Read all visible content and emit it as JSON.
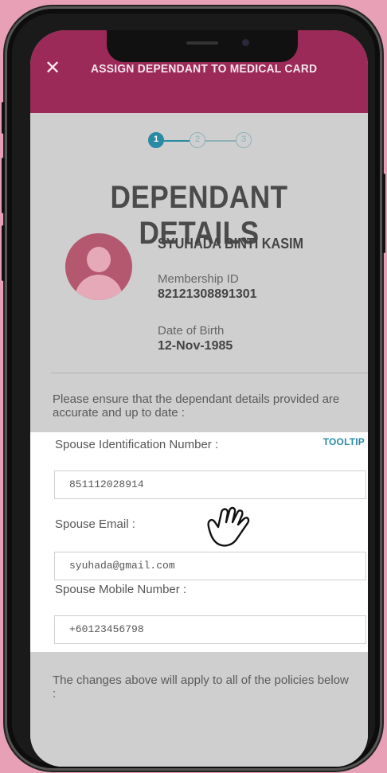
{
  "header": {
    "title": "ASSIGN DEPENDANT TO MEDICAL CARD",
    "close_icon": "close-icon"
  },
  "stepper": {
    "steps": [
      "1",
      "2",
      "3"
    ],
    "active": 1
  },
  "page_title": "DEPENDANT DETAILS",
  "dependant": {
    "name": "SYUHADA BINTI KASIM",
    "membership_label": "Membership ID",
    "membership_id": "82121308891301",
    "dob_label": "Date of Birth",
    "dob": "12-Nov-1985"
  },
  "instructions": "Please ensure that the dependant details provided are accurate and up to date :",
  "form": {
    "tooltip_label": "TOOLTIP",
    "id_label": "Spouse Identification Number :",
    "id_value": "851112028914",
    "email_label": "Spouse Email :",
    "email_value": "syuhada@gmail.com",
    "mobile_label": "Spouse Mobile Number :",
    "mobile_value": "+60123456798"
  },
  "footer_note": "The changes above will apply to all of the policies below :",
  "colors": {
    "header": "#9c2a58",
    "accent": "#2a8aa4",
    "background": "#e7a0b5"
  }
}
